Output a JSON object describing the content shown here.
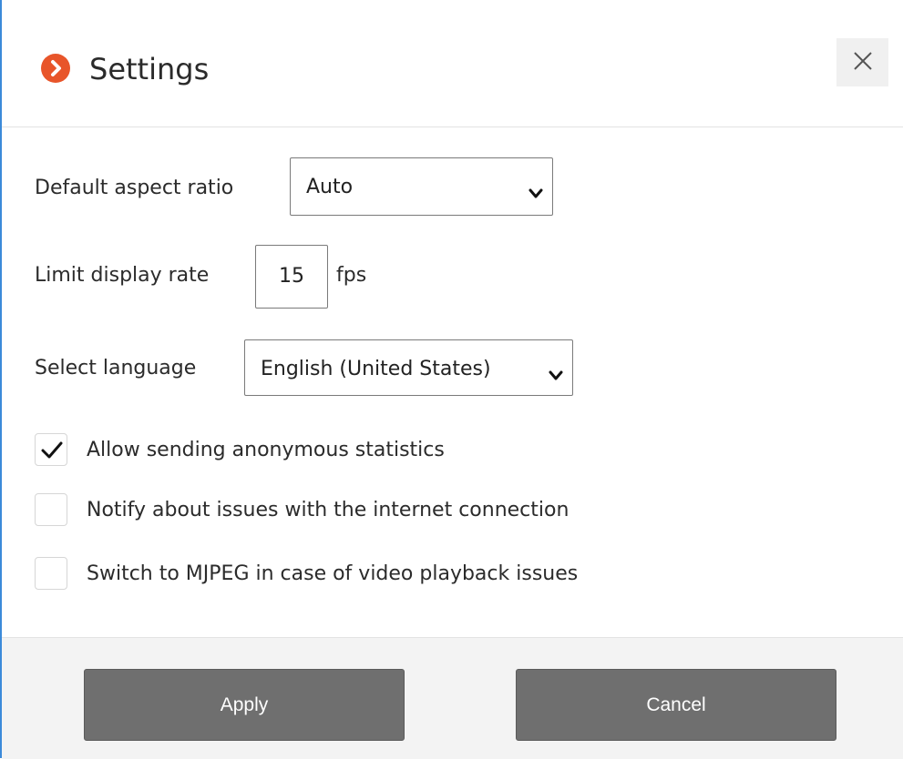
{
  "dialog": {
    "title": "Settings",
    "title_icon": "chevron-right-circle-icon",
    "close_icon": "close-icon",
    "accent_color": "#e8552a"
  },
  "settings": {
    "aspect_ratio": {
      "label": "Default aspect ratio",
      "selected": "Auto"
    },
    "display_rate": {
      "label": "Limit display rate",
      "value": "15",
      "unit": "fps"
    },
    "language": {
      "label": "Select language",
      "selected": "English (United States)"
    },
    "options": [
      {
        "label": "Allow sending anonymous statistics",
        "checked": true
      },
      {
        "label": "Notify about issues with the internet connection",
        "checked": false
      },
      {
        "label": "Switch to MJPEG in case of video playback issues",
        "checked": false
      }
    ]
  },
  "footer": {
    "apply_label": "Apply",
    "cancel_label": "Cancel",
    "button_color": "#6f6f6f"
  }
}
